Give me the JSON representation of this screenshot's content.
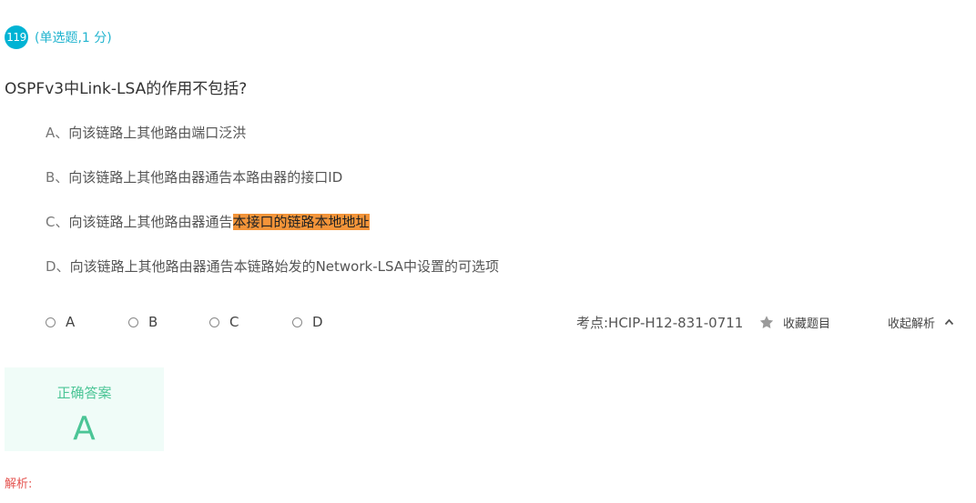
{
  "question": {
    "number": "119",
    "type_label": "(单选题,1 分)",
    "stem": "OSPFv3中Link-LSA的作用不包括?"
  },
  "options": [
    {
      "letter": "A、",
      "text": "向该链路上其他路由端口泛洪",
      "highlight": ""
    },
    {
      "letter": "B、",
      "text": "向该链路上其他路由器通告本路由器的接口ID",
      "highlight": ""
    },
    {
      "letter": "C、",
      "text": "向该链路上其他路由器通告",
      "highlight": "本接口的链路本地地址"
    },
    {
      "letter": "D、",
      "text": "向该链路上其他路由器通告本链路始发的Network-LSA中设置的可选项",
      "highlight": ""
    }
  ],
  "choices": [
    {
      "label": "A",
      "selected": false
    },
    {
      "label": "B",
      "selected": false
    },
    {
      "label": "C",
      "selected": false
    },
    {
      "label": "D",
      "selected": false
    }
  ],
  "meta": {
    "kaodian": "考点:HCIP-H12-831-0711",
    "favorite_label": "收藏题目",
    "favorite_icon": "star-icon",
    "collapse_label": "收起解析",
    "collapse_icon": "chevron-up-icon"
  },
  "answer": {
    "label": "正确答案",
    "value": "A"
  },
  "analysis": {
    "label": "解析:"
  },
  "colors": {
    "accent": "#00b3d4",
    "highlight": "#f39439",
    "answer_green": "#4bc596",
    "answer_bg": "#f0fcf8",
    "analysis_red": "#e4534f"
  }
}
